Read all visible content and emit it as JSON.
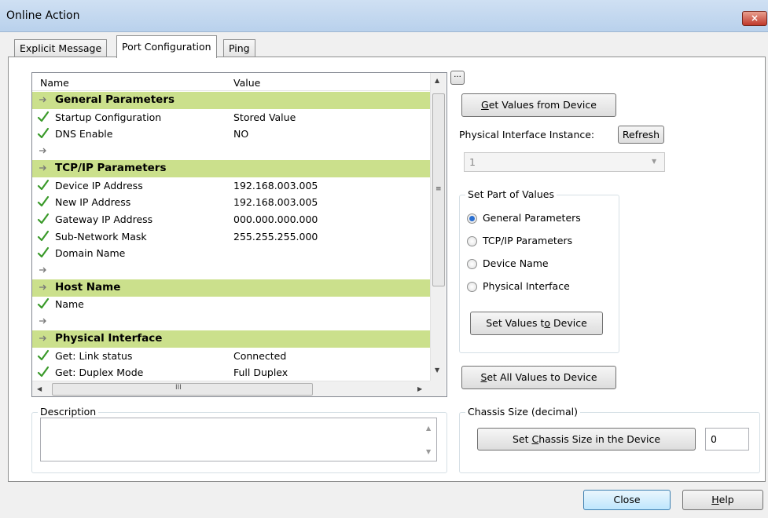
{
  "window": {
    "title": "Online Action",
    "close_glyph": "×"
  },
  "tabs": [
    {
      "label": "Explicit Message"
    },
    {
      "label": "Port Configuration"
    },
    {
      "label": "Ping"
    }
  ],
  "list": {
    "col_name": "Name",
    "col_value": "Value",
    "rows": [
      {
        "type": "section",
        "name": "General Parameters",
        "value": ""
      },
      {
        "type": "item",
        "name": "Startup Configuration",
        "value": "Stored Value"
      },
      {
        "type": "item",
        "name": "DNS Enable",
        "value": "NO"
      },
      {
        "type": "blank",
        "name": "",
        "value": ""
      },
      {
        "type": "section",
        "name": "TCP/IP Parameters",
        "value": ""
      },
      {
        "type": "item",
        "name": "Device IP Address",
        "value": "192.168.003.005"
      },
      {
        "type": "item",
        "name": "New IP Address",
        "value": "192.168.003.005"
      },
      {
        "type": "item",
        "name": "Gateway IP Address",
        "value": "000.000.000.000"
      },
      {
        "type": "item",
        "name": "Sub-Network Mask",
        "value": "255.255.255.000"
      },
      {
        "type": "item",
        "name": "Domain Name",
        "value": ""
      },
      {
        "type": "blank",
        "name": "",
        "value": ""
      },
      {
        "type": "section",
        "name": "Host Name",
        "value": ""
      },
      {
        "type": "item",
        "name": "Name",
        "value": ""
      },
      {
        "type": "blank",
        "name": "",
        "value": ""
      },
      {
        "type": "section",
        "name": "Physical Interface",
        "value": ""
      },
      {
        "type": "item",
        "name": "Get: Link status",
        "value": "Connected"
      },
      {
        "type": "item",
        "name": "Get: Duplex Mode",
        "value": "Full Duplex"
      }
    ],
    "hscroll_grip": "III"
  },
  "expand_button": "...",
  "right": {
    "get_values_pre": "",
    "get_values_key": "G",
    "get_values_post": "et Values from Device",
    "phys_label": "Physical Interface Instance:",
    "refresh_label": "Refresh",
    "instance_value": "1",
    "set_part_label": "Set Part of Values",
    "radios": [
      {
        "label": "General Parameters",
        "checked": true
      },
      {
        "label": "TCP/IP Parameters",
        "checked": false
      },
      {
        "label": "Device Name",
        "checked": false
      },
      {
        "label": "Physical Interface",
        "checked": false
      }
    ],
    "set_values_pre": "Set Values t",
    "set_values_key": "o",
    "set_values_post": " Device",
    "set_all_pre": "",
    "set_all_key": "S",
    "set_all_post": "et All Values to Device"
  },
  "description": {
    "label": "Description"
  },
  "chassis": {
    "label": "Chassis Size (decimal)",
    "btn_pre": "Set ",
    "btn_key": "C",
    "btn_post": "hassis Size in the Device",
    "value": "0"
  },
  "footer": {
    "close_label": "Close",
    "help_key": "H",
    "help_post": "elp"
  },
  "colors": {
    "section": "#cbe08c",
    "check": "#3a9a2a",
    "titlebar": "#c4d8ef"
  }
}
